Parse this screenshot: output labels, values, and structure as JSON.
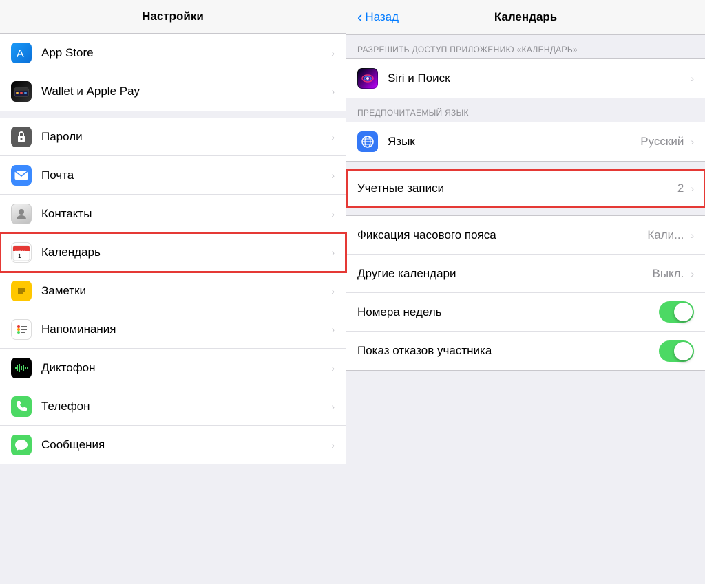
{
  "left": {
    "header": "Настройки",
    "groups": [
      {
        "items": [
          {
            "id": "appstore",
            "label": "App Store",
            "iconType": "appstore"
          },
          {
            "id": "wallet",
            "label": "Wallet и Apple Pay",
            "iconType": "wallet"
          }
        ]
      },
      {
        "items": [
          {
            "id": "passwords",
            "label": "Пароли",
            "iconType": "passwords"
          },
          {
            "id": "mail",
            "label": "Почта",
            "iconType": "mail"
          },
          {
            "id": "contacts",
            "label": "Контакты",
            "iconType": "contacts"
          },
          {
            "id": "calendar",
            "label": "Календарь",
            "iconType": "calendar",
            "highlighted": true
          },
          {
            "id": "notes",
            "label": "Заметки",
            "iconType": "notes"
          },
          {
            "id": "reminders",
            "label": "Напоминания",
            "iconType": "reminders"
          },
          {
            "id": "voice",
            "label": "Диктофон",
            "iconType": "voice"
          },
          {
            "id": "phone",
            "label": "Телефон",
            "iconType": "phone"
          },
          {
            "id": "messages",
            "label": "Сообщения",
            "iconType": "messages"
          }
        ]
      }
    ]
  },
  "right": {
    "header": "Календарь",
    "back_label": "Назад",
    "sections": [
      {
        "label": "РАЗРЕШИТЬ ДОСТУП ПРИЛОЖЕНИЮ «КАЛЕНДАРЬ»",
        "items": [
          {
            "id": "siri",
            "label": "Siri и Поиск",
            "iconType": "siri",
            "hasIcon": true
          }
        ]
      },
      {
        "label": "ПРЕДПОЧИТАЕМЫЙ ЯЗЫК",
        "items": [
          {
            "id": "language",
            "label": "Язык",
            "iconType": "globe",
            "hasIcon": true,
            "value": "Русский"
          }
        ]
      },
      {
        "label": "",
        "items": [
          {
            "id": "accounts",
            "label": "Учетные записи",
            "hasIcon": false,
            "value": "2",
            "highlighted": true
          }
        ]
      },
      {
        "label": "",
        "items": [
          {
            "id": "timezone",
            "label": "Фиксация часового пояса",
            "hasIcon": false,
            "value": "Кали..."
          },
          {
            "id": "other-calendars",
            "label": "Другие календари",
            "hasIcon": false,
            "value": "Выкл."
          },
          {
            "id": "week-numbers",
            "label": "Номера недель",
            "hasIcon": false,
            "toggle": true,
            "toggleOn": true
          },
          {
            "id": "decline-events",
            "label": "Показ отказов участника",
            "hasIcon": false,
            "toggle": true,
            "toggleOn": true
          }
        ]
      }
    ]
  }
}
